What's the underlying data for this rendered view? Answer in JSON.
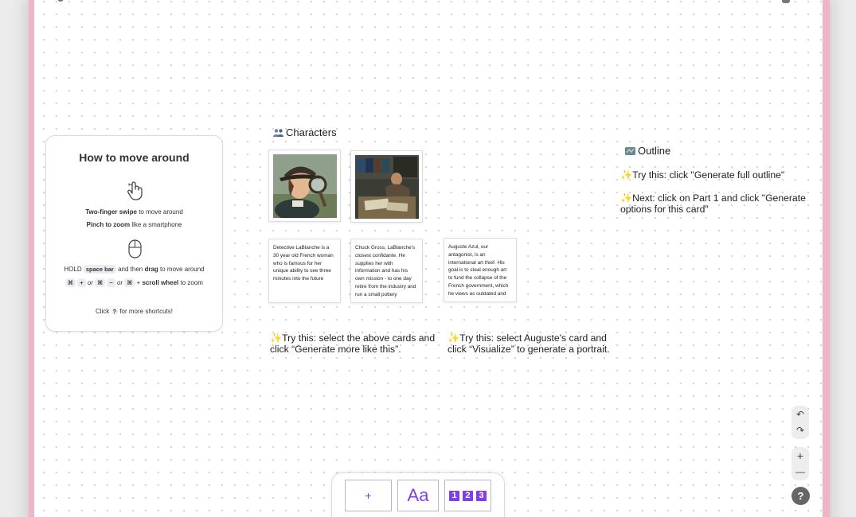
{
  "help": {
    "title": "How to move around",
    "swipe_bold": "Two-finger swipe",
    "swipe_rest": " to move around",
    "pinch_bold": "Pinch to zoom",
    "pinch_rest": " like a smartphone",
    "hold": "HOLD ",
    "space_key": "space bar",
    "then": " and then ",
    "drag_bold": "drag",
    "drag_rest": " to move around",
    "cmd": "⌘",
    "plus_key": "+",
    "or1": " or ",
    "minus_key": "−",
    "or2": " or ",
    "plus_sign": " + ",
    "scroll_bold": "scroll wheel",
    "zoom_rest": " to zoom",
    "click": "Click ",
    "q_key": "?",
    "shortcuts": " for more shortcuts!"
  },
  "characters": {
    "title": "Characters",
    "cards": [
      "Detective LaBlanche is a 30 year old French woman who is famous for her unique ability to see three minutes into the future",
      "Chuck Gross, LaBlanche's closest confidante. He supplies her with information and has his own mission - to one day retire from the industry and run a small pottery",
      "Auguste Azul, our antagonist, is an international art thief. His goal is to steal enough art to fund the collapse of the French government, which he views as outdated and"
    ]
  },
  "outline": {
    "title": "Outline",
    "tip1": "✨Try this: click \"Generate full outline\"",
    "tip2": "✨Next: click on Part 1 and click \"Generate options for this card\""
  },
  "tips": {
    "left": "✨Try this: select the above cards and click “Generate more like this”.",
    "right": "✨Try this: select Auguste's card and click “Visualize” to generate a portrait."
  },
  "controls": {
    "undo": "↶",
    "redo": "↷",
    "zoom_in": "+",
    "zoom_out": "—",
    "help": "?"
  },
  "toolbar": {
    "add": "+",
    "text": "Aa",
    "numbers": [
      "1",
      "2",
      "3"
    ]
  },
  "colors": {
    "accent": "#7e3fe3",
    "frame": "#f2b3c6"
  }
}
